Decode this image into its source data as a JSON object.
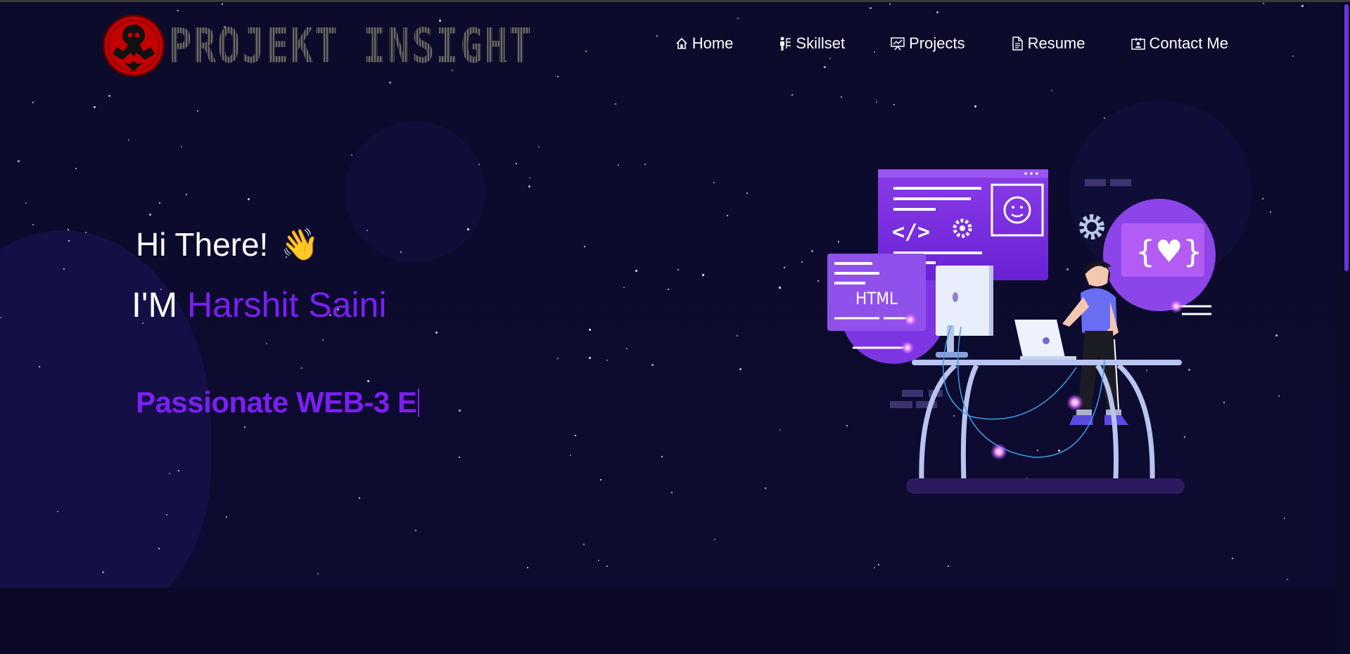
{
  "brand": {
    "logo_text": "PROJEKT INSIGHT",
    "accent_color": "#7b1ff4",
    "background_color": "#0b0a28",
    "logo_color": "#d40000"
  },
  "nav": {
    "items": [
      {
        "label": "Home",
        "icon": "home-icon"
      },
      {
        "label": "Skillset",
        "icon": "person-skill-icon"
      },
      {
        "label": "Projects",
        "icon": "presentation-chart-icon"
      },
      {
        "label": "Resume",
        "icon": "document-icon"
      },
      {
        "label": "Contact Me",
        "icon": "contact-card-icon"
      }
    ]
  },
  "hero": {
    "greeting": "Hi There!",
    "wave_emoji": "👋",
    "intro_prefix": "I'M ",
    "name": "Harshit Saini",
    "typed_text": "Passionate WEB-3 E"
  },
  "illustration": {
    "html_tag": "HTML",
    "code_tag": "</>",
    "braces_icon": "{♥}"
  }
}
